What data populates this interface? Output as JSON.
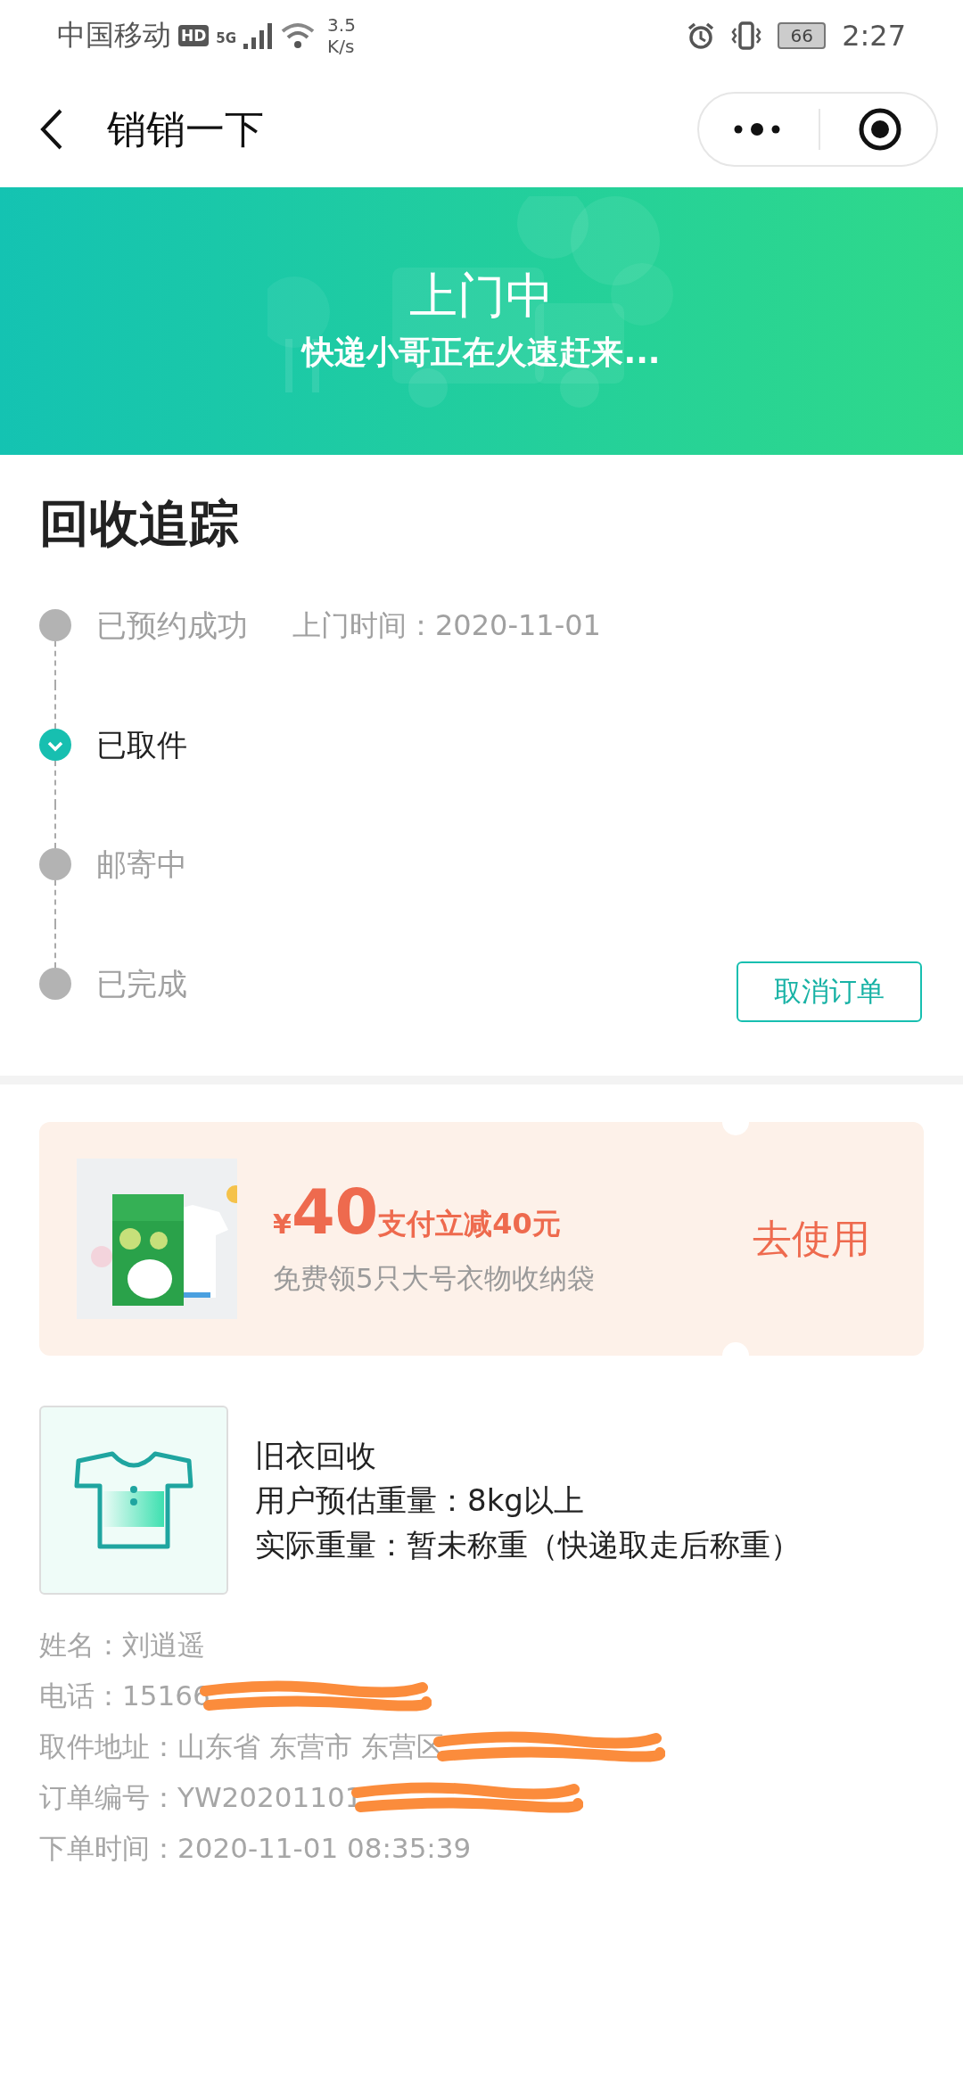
{
  "status_bar": {
    "carrier": "中国移动",
    "hd": "HD",
    "network": "5G",
    "speed_value": "3.5",
    "speed_unit": "K/s",
    "battery": "66",
    "time": "2:27"
  },
  "nav": {
    "title": "销销一下"
  },
  "banner": {
    "title": "上门中",
    "subtitle": "快递小哥正在火速赶来..."
  },
  "tracking": {
    "title": "回收追踪",
    "steps": [
      {
        "label": "已预约成功",
        "note": "上门时间：2020-11-01",
        "selected": false
      },
      {
        "label": "已取件",
        "selected": true
      },
      {
        "label": "邮寄中",
        "selected": false
      },
      {
        "label": "已完成",
        "selected": false
      }
    ],
    "cancel_button": "取消订单"
  },
  "coupon": {
    "currency": "¥",
    "amount": "40",
    "headline": "支付立减40元",
    "description": "免费领5只大号衣物收纳袋",
    "action": "去使用"
  },
  "product": {
    "name": "旧衣回收",
    "estimated_weight": "用户预估重量：8kg以上",
    "actual_weight": "实际重量：暂未称重（快递取走后称重）"
  },
  "details": [
    {
      "text": "姓名：刘逍遥",
      "redacted": false
    },
    {
      "text": "电话：15166",
      "redacted": true
    },
    {
      "text": "取件地址：山东省 东营市 东营区",
      "redacted": true
    },
    {
      "text": "订单编号：YW20201101",
      "redacted": true
    },
    {
      "text": "下单时间：2020-11-01 08:35:39",
      "redacted": false
    }
  ]
}
